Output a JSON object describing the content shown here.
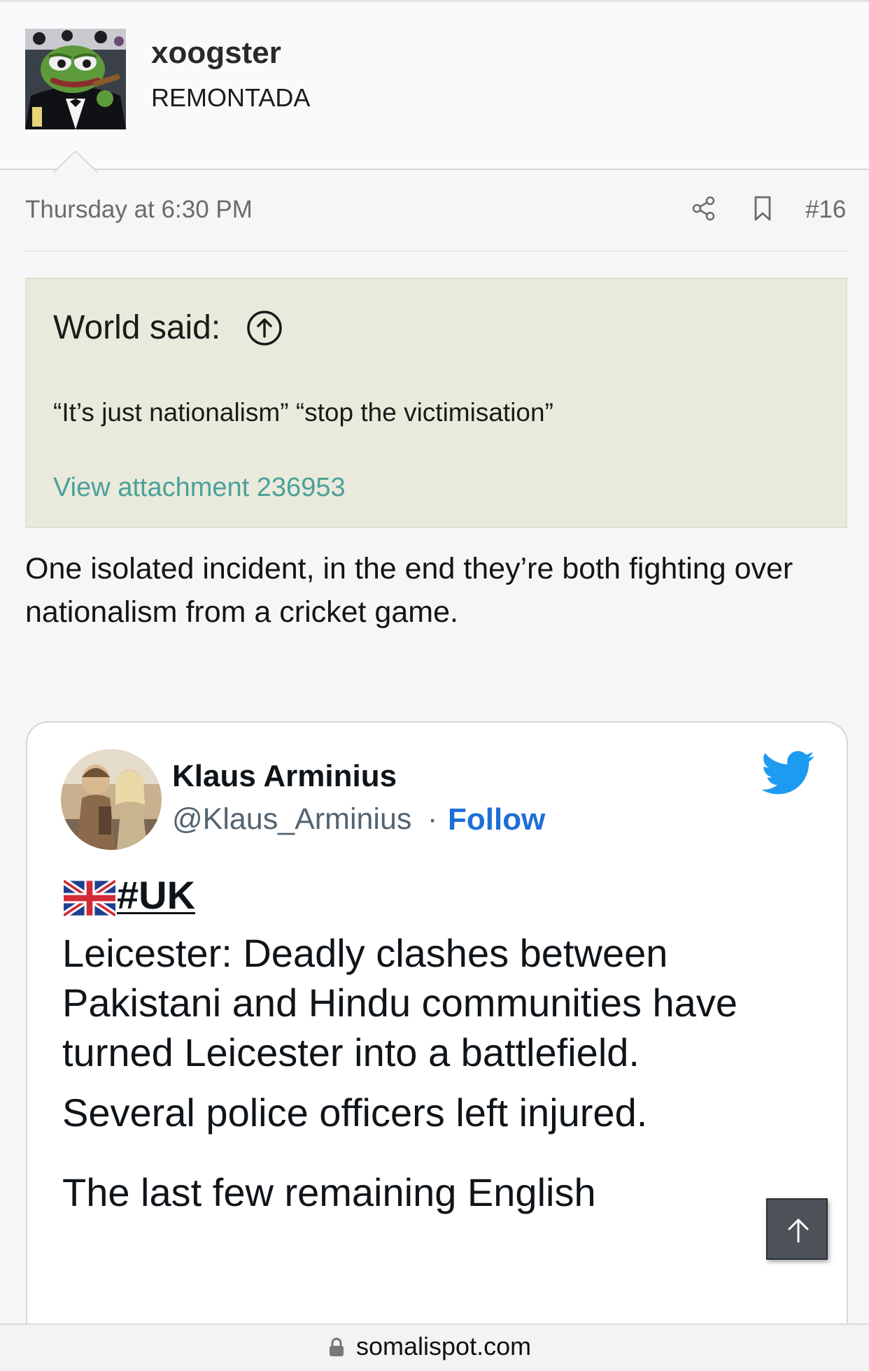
{
  "user": {
    "name": "xoogster",
    "title": "REMONTADA"
  },
  "post_meta": {
    "date": "Thursday at 6:30 PM",
    "number": "#16"
  },
  "quote": {
    "author_label": "World said:",
    "text": "“It’s just nationalism” “stop the victimisation”",
    "attachment_link": "View attachment 236953"
  },
  "post_body": "One isolated incident, in the end they’re both fighting over nationalism from a cricket game.",
  "tweet": {
    "author_name": "Klaus Arminius",
    "handle": "@Klaus_Arminius",
    "separator": "·",
    "follow_label": "Follow",
    "hashtag": "#UK",
    "paragraphs": [
      "Leicester: Deadly clashes between Pakistani and Hindu communities have turned Leicester into a battlefield.",
      "Several police officers left injured.",
      "The last few remaining English"
    ]
  },
  "browser": {
    "url": "somalispot.com"
  },
  "colors": {
    "quote_background": "#eaeadc",
    "link_teal": "#4aa199",
    "twitter_blue": "#1d9bf0",
    "follow_blue": "#1d6fd6"
  },
  "icons": {
    "share": "share-icon",
    "bookmark": "bookmark-icon",
    "quote_jump": "arrow-up-circle-icon",
    "twitter": "twitter-bird-icon",
    "scroll_top": "arrow-up-icon",
    "lock": "lock-icon"
  }
}
